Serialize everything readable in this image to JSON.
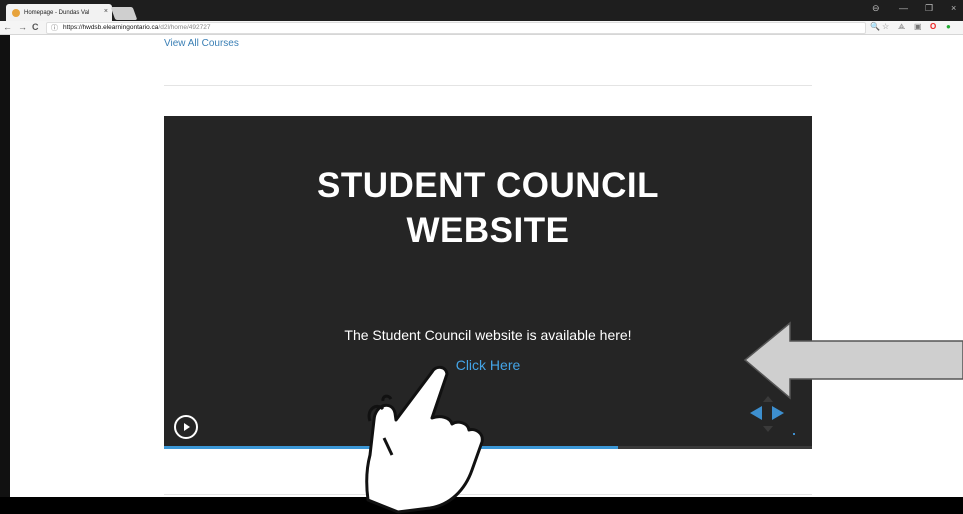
{
  "browser": {
    "tab_title": "Homepage - Dundas Val",
    "tab_close": "×",
    "url_host": "https://hwdsb.elearningontario.ca",
    "url_path": "/d2l/home/492727",
    "lock_icon": "ⓘ",
    "window_controls": [
      "⊖",
      "—",
      "❐",
      "×"
    ],
    "nav": {
      "back": "←",
      "forward": "→",
      "reload": "C"
    },
    "extensions": [
      "🔍",
      "☆",
      "⟁",
      "▣",
      "O",
      "●"
    ]
  },
  "page": {
    "view_all_courses": "View All Courses",
    "slide": {
      "title": "STUDENT COUNCIL\nWEBSITE",
      "subtitle": "The Student Council website is available here!",
      "link": "Click Here",
      "progress": 0.7
    }
  },
  "colors": {
    "link": "#3a7fb5",
    "slide_bg": "#252525",
    "slide_link": "#44a4e6",
    "progress": "#3b97d6",
    "arrow_annotation": "#cfcfcf"
  },
  "annotations": {
    "pointer_hand": "pointing-hand-icon",
    "arrow": "left-arrow-icon"
  }
}
